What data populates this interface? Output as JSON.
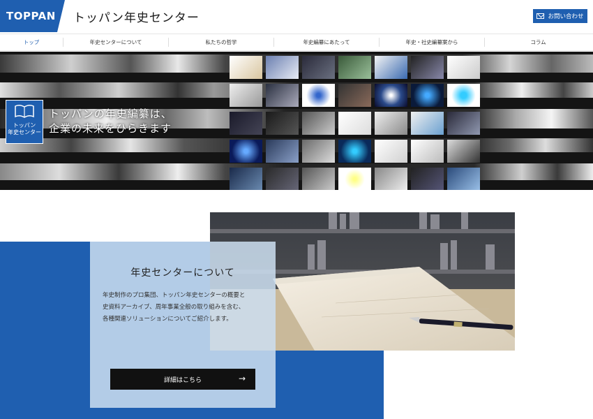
{
  "header": {
    "logo_text": "TOPPAN",
    "site_title": "トッパン年史センター",
    "contact_label": "お問い合わせ"
  },
  "nav": {
    "items": [
      {
        "label": "トップ",
        "active": true
      },
      {
        "label": "年史センターについて"
      },
      {
        "label": "私たちの哲学"
      },
      {
        "label": "年史編纂にあたって"
      },
      {
        "label": "年史・社史編纂案から"
      },
      {
        "label": "コラム"
      }
    ]
  },
  "hero": {
    "badge_label_line1": "トッパン",
    "badge_label_line2": "年史センター",
    "copy_line1": "トッパンの年史編纂は、",
    "copy_line2": "企業の未来をひらきます"
  },
  "about": {
    "title": "年史センターについて",
    "text_line1": "年史制作のプロ集団、トッパン年史センターの概要と",
    "text_line2": "史資料アーカイブ、周年事業全般の取り組みを含む、",
    "text_line3": "各種関連ソリューションについてご紹介します。",
    "button_label": "詳細はこちら",
    "button_arrow": "→"
  },
  "colors": {
    "brand_blue": "#1f5fb0",
    "card_bg": "#ccdef0",
    "button_bg": "#111111"
  }
}
